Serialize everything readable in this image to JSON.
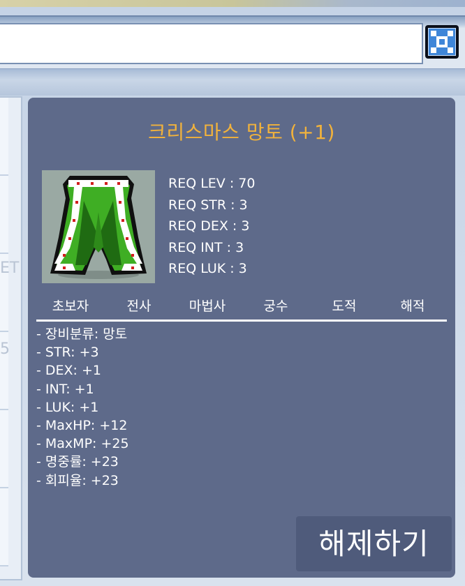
{
  "colors": {
    "tooltip_bg": "#5e6a8a",
    "title_color": "#f1b23c",
    "text_color": "#ffffff",
    "button_bg": "#4f5b7b"
  },
  "window": {
    "close_icon": "close-icon"
  },
  "left_panel": {
    "faint_text_1": "ET",
    "faint_text_2": "5"
  },
  "item": {
    "title": "크리스마스 망토  (+1)",
    "icon": "green-cape-icon",
    "requirements": [
      "REQ LEV : 70",
      "REQ STR : 3",
      "REQ DEX : 3",
      "REQ INT : 3",
      "REQ LUK : 3"
    ],
    "jobs": [
      "초보자",
      "전사",
      "마법사",
      "궁수",
      "도적",
      "해적"
    ],
    "stats": [
      "- 장비분류: 망토",
      "- STR: +3",
      "- DEX: +1",
      "- INT: +1",
      "- LUK: +1",
      "- MaxHP: +12",
      "- MaxMP: +25",
      "- 명중률: +23",
      "- 회피율: +23"
    ]
  },
  "actions": {
    "unequip_label": "해제하기"
  }
}
